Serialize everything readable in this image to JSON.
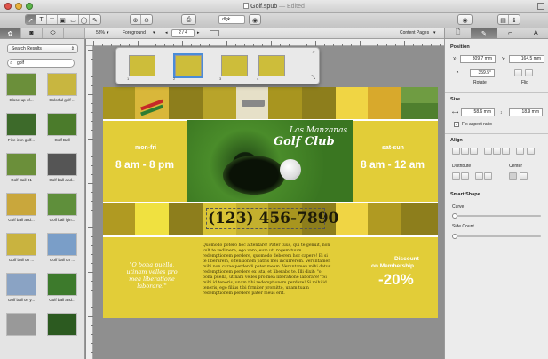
{
  "window": {
    "title": "Golf.spub",
    "status": "— Edited"
  },
  "toolbar": {
    "font_name": "dlgk",
    "page_label": "2 / 4",
    "zoom": "58%",
    "layer": "Foreground",
    "content_pages": "Content Pages"
  },
  "sidebar": {
    "results_select": "Search Results",
    "search_value": "golf",
    "thumbs": [
      {
        "label": "Close-up of...",
        "color": "#6b8f3a"
      },
      {
        "label": "Colorful golf ...",
        "color": "#c8b640"
      },
      {
        "label": "Five iron golf...",
        "color": "#3d6a2a"
      },
      {
        "label": "Golf Ball",
        "color": "#4b7b2b"
      },
      {
        "label": "Golf Ball 01",
        "color": "#6b8f3a"
      },
      {
        "label": "Golf ball and...",
        "color": "#555555"
      },
      {
        "label": "Golf ball and...",
        "color": "#c9a73c"
      },
      {
        "label": "Golf ball lyin...",
        "color": "#5f8f3b"
      },
      {
        "label": "Golf ball on ...",
        "color": "#c9b33f"
      },
      {
        "label": "Golf ball on ...",
        "color": "#7a9ec8"
      },
      {
        "label": "Golf ball on y...",
        "color": "#8aa3c4"
      },
      {
        "label": "Golf ball and...",
        "color": "#3d7a2c"
      },
      {
        "label": "",
        "color": "#999999"
      },
      {
        "label": "",
        "color": "#2c5a20"
      }
    ]
  },
  "document": {
    "title_line1": "Las Manzanas",
    "title_line2": "Golf Club",
    "left_days": "mon-fri",
    "left_hours": "8 am - 8 pm",
    "right_days": "sat-sun",
    "right_hours": "8 am - 12 am",
    "phone": "(123) 456-7890",
    "quote": "\"O bona puella, utinam velles pro mea liberatione laborare!\"",
    "body_text": "Quomodo potero hoc attentare! Pater tuus, qui te genuit, non vult te redimere, ego vero, eum uti rogem tuum redemptionem perdere, quomodo deberem hoc capere! Ei si te liberarem, offensionem patris mei incurrerem. Veruntamen mihi non curae perdendi peter meam. Veruntamen mihi datur redemptionem perdere ex ista, et liberabo te. Illi dixit: \"o bona puella, utinam velles pro mea liberatione laborare!\" Si mihi id teneris, unam tibi redemptionem perdere! Si mihi id teneris, ego filius tibi firmiter promitto, unam tuam redemptionem perdere pater meus erit.",
    "discount_line1": "Discount",
    "discount_line2": "on Membership",
    "discount_value": "-20%"
  },
  "inspector": {
    "position_label": "Position",
    "x_label": "X:",
    "x_value": "309.7 mm",
    "y_label": "Y:",
    "y_value": "164.5 mm",
    "rotate_value": "359.5°",
    "rotate_label": "Rotate",
    "flip_label": "Flip",
    "size_label": "Size",
    "width_value": "58.6 mm",
    "height_value": "18.9 mm",
    "fix_aspect": "Fix aspect ratio",
    "align_label": "Align",
    "distribute_label": "Distribute",
    "center_label": "Center",
    "smart_shape_label": "Smart Shape",
    "curve_label": "Curve",
    "side_count_label": "Side Count"
  },
  "colors": {
    "doc_yellow": "#e2cd38",
    "dark_olive": "#8d7e1c",
    "light_yellow": "#f0e140"
  }
}
